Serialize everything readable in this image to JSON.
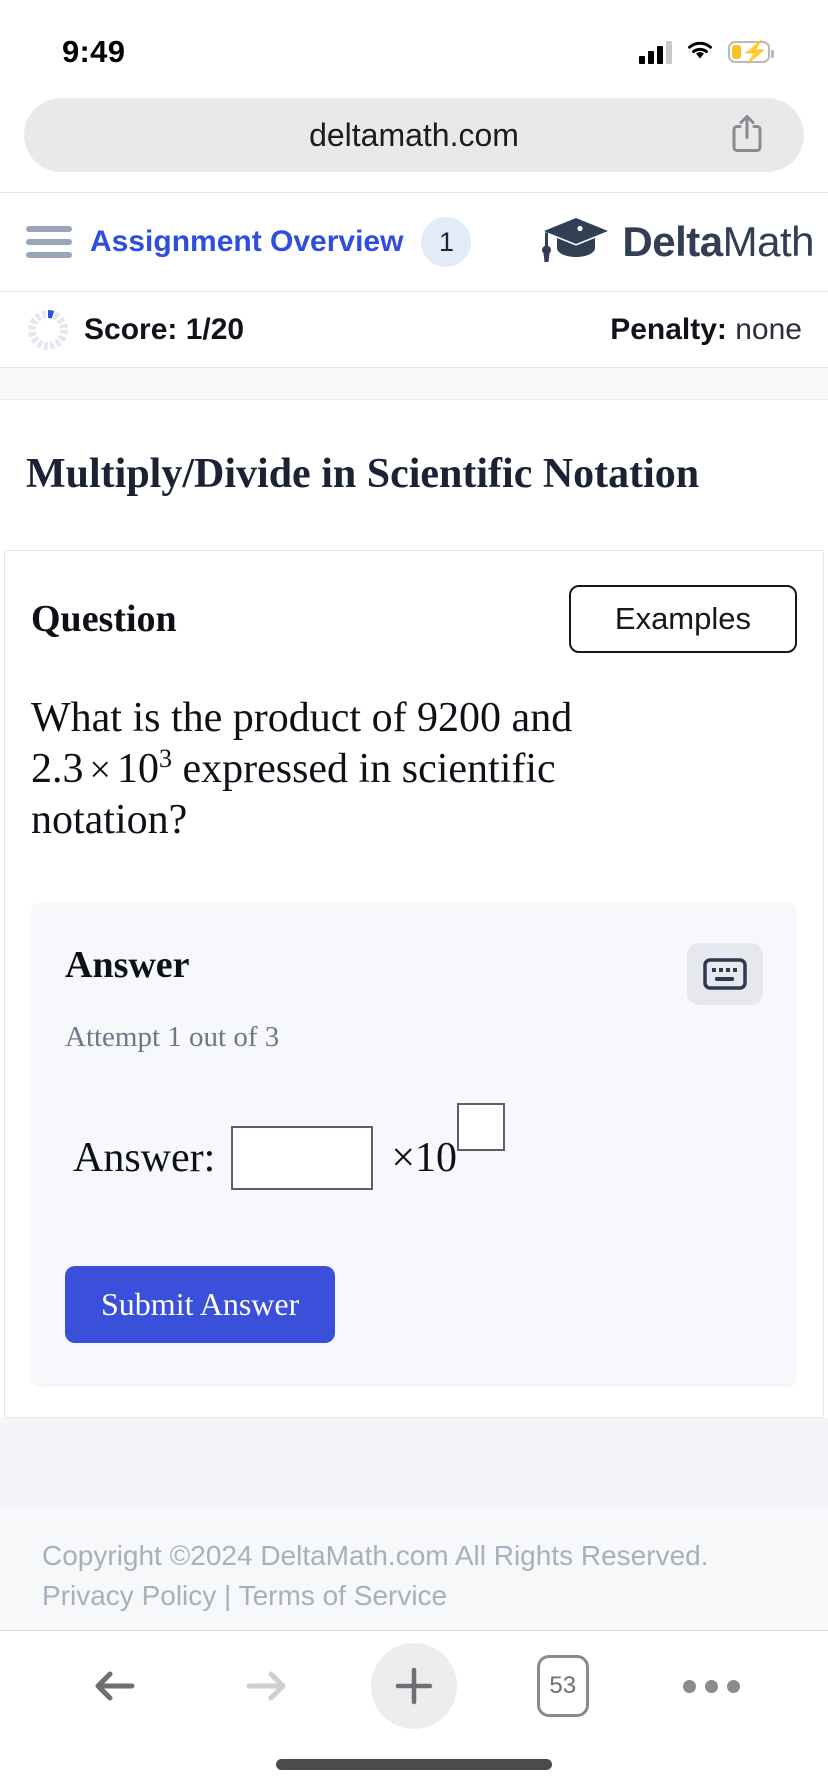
{
  "status_bar": {
    "time": "9:49",
    "signal_icon": "cellular-signal-icon",
    "wifi_icon": "wifi-icon",
    "battery_icon": "battery-charging-icon"
  },
  "browser": {
    "url": "deltamath.com",
    "share_icon": "share-icon",
    "bottom_toolbar": {
      "back_icon": "back-arrow-icon",
      "forward_icon": "forward-arrow-icon",
      "new_tab_icon": "plus-icon",
      "tab_count": "53",
      "more_icon": "more-dots-icon"
    }
  },
  "nav": {
    "menu_icon": "hamburger-menu-icon",
    "link_label": "Assignment Overview",
    "badge": "1",
    "logo_icon": "graduation-cap-icon",
    "logo_bold": "Delta",
    "logo_light": "Math"
  },
  "score_bar": {
    "progress_icon": "score-ring-icon",
    "score_label": "Score: 1/20",
    "penalty_label": "Penalty:",
    "penalty_value": "none"
  },
  "assignment": {
    "title": "Multiply/Divide in Scientific Notation"
  },
  "question": {
    "heading": "Question",
    "examples_button": "Examples",
    "line1": "What is the product of 9200 and",
    "operand": "2.3",
    "times": "×",
    "base": "10",
    "exponent": "3",
    "line2_tail": "expressed in scientific",
    "line3": "notation?"
  },
  "answer": {
    "heading": "Answer",
    "keyboard_icon": "keyboard-icon",
    "attempt": "Attempt 1 out of 3",
    "label": "Answer:",
    "input_value": "",
    "times_ten": "×10",
    "exponent_value": "",
    "submit_label": "Submit Answer"
  },
  "footer": {
    "copyright": "Copyright ©2024 DeltaMath.com All Rights Reserved.",
    "privacy": "Privacy Policy",
    "separator": "|",
    "terms": "Terms of Service"
  },
  "colors": {
    "accent_blue": "#2f4de0",
    "submit_blue": "#3a4fda",
    "logo_navy": "#323e53",
    "muted_gray": "#a9b0bd"
  }
}
